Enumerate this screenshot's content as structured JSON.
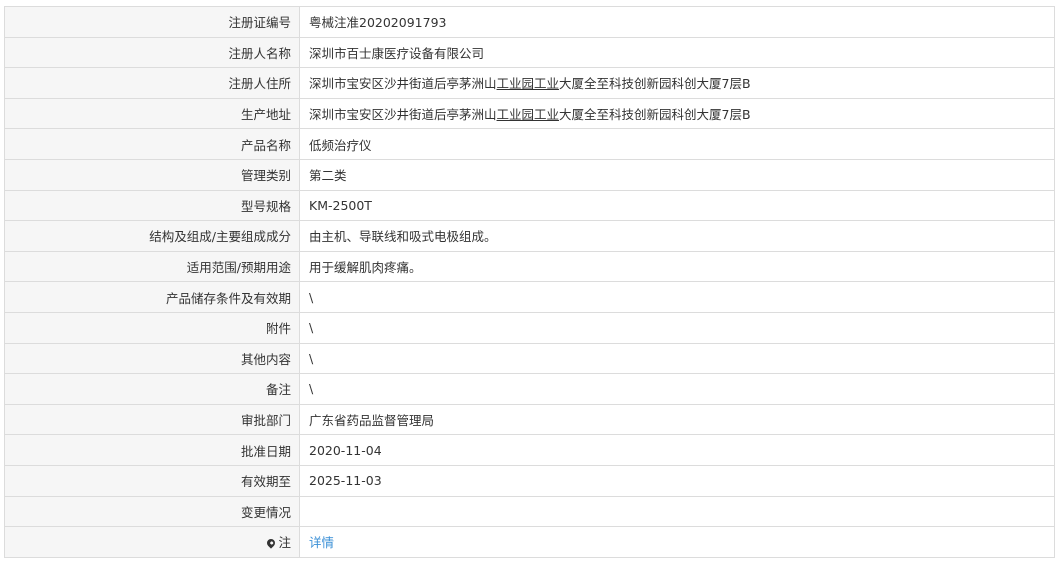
{
  "rows": [
    {
      "label": "注册证编号",
      "value": "粤械注准20202091793"
    },
    {
      "label": "注册人名称",
      "value": "深圳市百士康医疗设备有限公司"
    },
    {
      "label": "注册人住所",
      "value_before": "深圳市宝安区沙井街道后亭茅洲山",
      "value_underlined": "工业园工业",
      "value_after": "大厦全至科技创新园科创大厦7层B"
    },
    {
      "label": "生产地址",
      "value_before": "深圳市宝安区沙井街道后亭茅洲山",
      "value_underlined": "工业园工业",
      "value_after": "大厦全至科技创新园科创大厦7层B"
    },
    {
      "label": "产品名称",
      "value": "低频治疗仪"
    },
    {
      "label": "管理类别",
      "value": "第二类"
    },
    {
      "label": "型号规格",
      "value": "KM-2500T"
    },
    {
      "label": "结构及组成/主要组成成分",
      "value": "由主机、导联线和吸式电极组成。"
    },
    {
      "label": "适用范围/预期用途",
      "value": "用于缓解肌肉疼痛。"
    },
    {
      "label": "产品储存条件及有效期",
      "value": "\\"
    },
    {
      "label": "附件",
      "value": "\\"
    },
    {
      "label": "其他内容",
      "value": "\\"
    },
    {
      "label": "备注",
      "value": "\\"
    },
    {
      "label": "审批部门",
      "value": "广东省药品监督管理局"
    },
    {
      "label": "批准日期",
      "value": "2020-11-04"
    },
    {
      "label": "有效期至",
      "value": "2025-11-03"
    },
    {
      "label": "变更情况",
      "value": ""
    },
    {
      "label": "注",
      "icon": "map-pin-icon",
      "link": "详情"
    }
  ],
  "colors": {
    "label_bg": "#f6f6f6",
    "border": "#dcdcdc",
    "text": "#333333",
    "link": "#3a8fd6"
  }
}
